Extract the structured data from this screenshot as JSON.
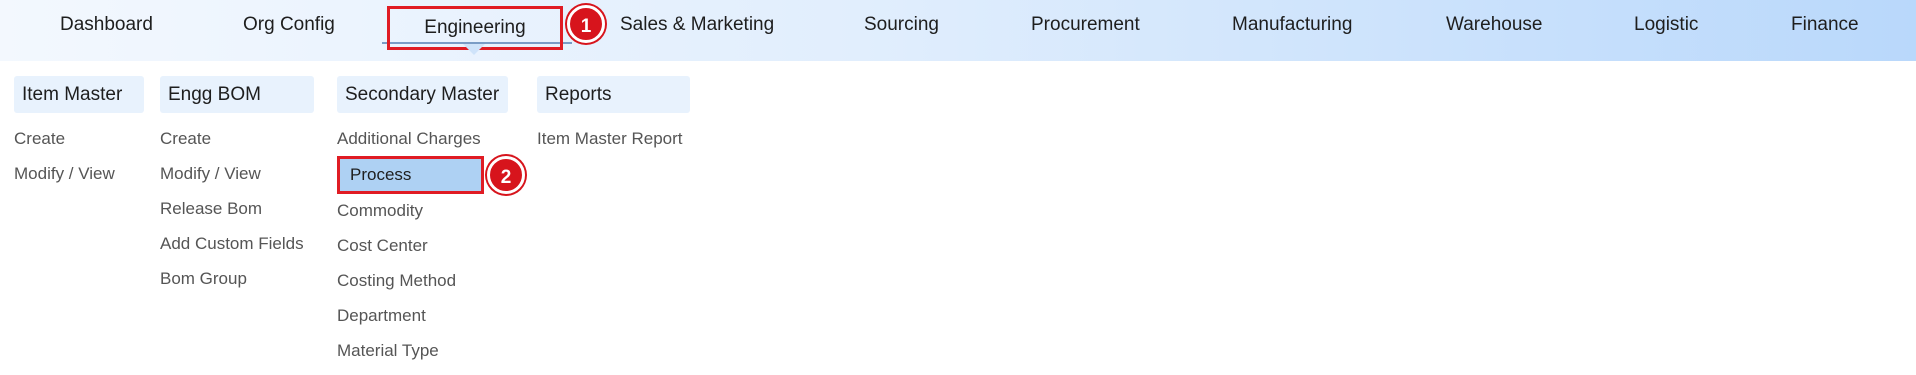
{
  "nav": [
    {
      "label": "Dashboard"
    },
    {
      "label": "Org Config"
    },
    {
      "label": "Engineering"
    },
    {
      "label": "Sales & Marketing"
    },
    {
      "label": "Sourcing"
    },
    {
      "label": "Procurement"
    },
    {
      "label": "Manufacturing"
    },
    {
      "label": "Warehouse"
    },
    {
      "label": "Logistic"
    },
    {
      "label": "Finance"
    }
  ],
  "markers": {
    "step1": "1",
    "step2": "2"
  },
  "columns": [
    {
      "title": "Item Master",
      "items": [
        "Create",
        "Modify / View"
      ]
    },
    {
      "title": "Engg BOM",
      "items": [
        "Create",
        "Modify / View",
        "Release Bom",
        "Add Custom Fields",
        "Bom Group"
      ]
    },
    {
      "title": "Secondary Master",
      "items": [
        "Additional Charges",
        "Process",
        "Commodity",
        "Cost Center",
        "Costing Method",
        "Department",
        "Material Type"
      ]
    },
    {
      "title": "Reports",
      "items": [
        "Item Master Report"
      ]
    }
  ],
  "colors": {
    "highlight_border": "#e01c24",
    "highlight_fill": "#aed1f3",
    "badge": "#d7141c"
  }
}
